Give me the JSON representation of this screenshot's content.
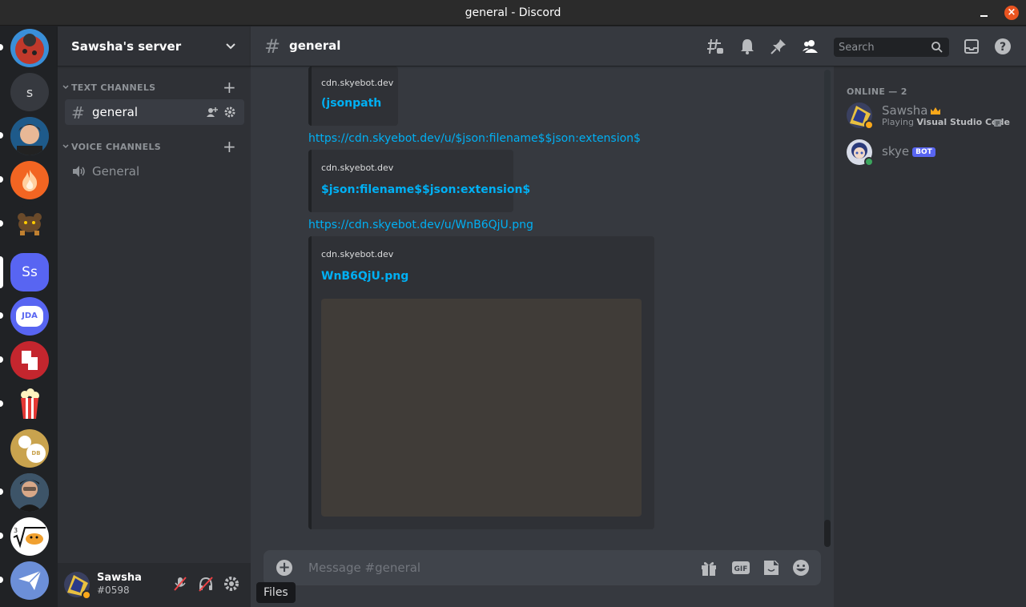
{
  "window": {
    "title": "general - Discord",
    "close_glyph": "×"
  },
  "rail": {
    "servers": [
      {
        "label": "",
        "bg": "#3a8fd8",
        "name": "server-ladybug"
      },
      {
        "label": "s",
        "bg": "#36393f",
        "name": "server-s"
      },
      {
        "label": "",
        "bg": "#5a4030",
        "name": "server-anime"
      },
      {
        "label": "",
        "bg": "#f26522",
        "name": "server-fire"
      },
      {
        "label": "",
        "bg": "#202225",
        "name": "server-bear"
      },
      {
        "label": "Ss",
        "bg": "#5865f2",
        "name": "server-sawsha"
      },
      {
        "label": "JDA",
        "bg": "#5865f2",
        "name": "server-jda"
      },
      {
        "label": "",
        "bg": "#c4262e",
        "name": "server-red"
      },
      {
        "label": "",
        "bg": "#202225",
        "name": "server-popcorn"
      },
      {
        "label": "DB Club",
        "bg": "#c9a34e",
        "name": "server-dbclub"
      },
      {
        "label": "",
        "bg": "#4a6a8a",
        "name": "server-person"
      },
      {
        "label": "",
        "bg": "#ffffff",
        "name": "server-math"
      },
      {
        "label": "",
        "bg": "#6c8fd8",
        "name": "server-mail"
      }
    ]
  },
  "guild": {
    "name": "Sawsha's server"
  },
  "sidebar": {
    "text_category": "TEXT CHANNELS",
    "voice_category": "VOICE CHANNELS",
    "text_channel": "general",
    "voice_channel": "General",
    "hash_glyph": "#",
    "plus_glyph": "+"
  },
  "user": {
    "name": "Sawsha",
    "discriminator": "#0598"
  },
  "header": {
    "hash_glyph": "#",
    "channel": "general",
    "search_placeholder": "Search"
  },
  "messages": {
    "embed1": {
      "provider": "cdn.skyebot.dev",
      "title": "(jsonpath"
    },
    "link2": "https://cdn.skyebot.dev/u/$json:filename$$json:extension$",
    "embed2": {
      "provider": "cdn.skyebot.dev",
      "title": "$json:filename$$json:extension$"
    },
    "link3": "https://cdn.skyebot.dev/u/WnB6QjU.png",
    "embed3": {
      "provider": "cdn.skyebot.dev",
      "title": "WnB6QjU.png"
    }
  },
  "composer": {
    "placeholder": "Message #general",
    "add_glyph": "+"
  },
  "tooltip": {
    "text": "Files"
  },
  "members": {
    "heading": "ONLINE — 2",
    "list": [
      {
        "name": "Sawsha",
        "status_prefix": "Playing ",
        "status_game": "Visual Studio Code"
      },
      {
        "name": "skye",
        "badge": "BOT"
      }
    ]
  },
  "colors": {
    "accent": "#5865f2",
    "link": "#00b0f4",
    "online": "#3ba55d",
    "idle": "#faa81a"
  }
}
